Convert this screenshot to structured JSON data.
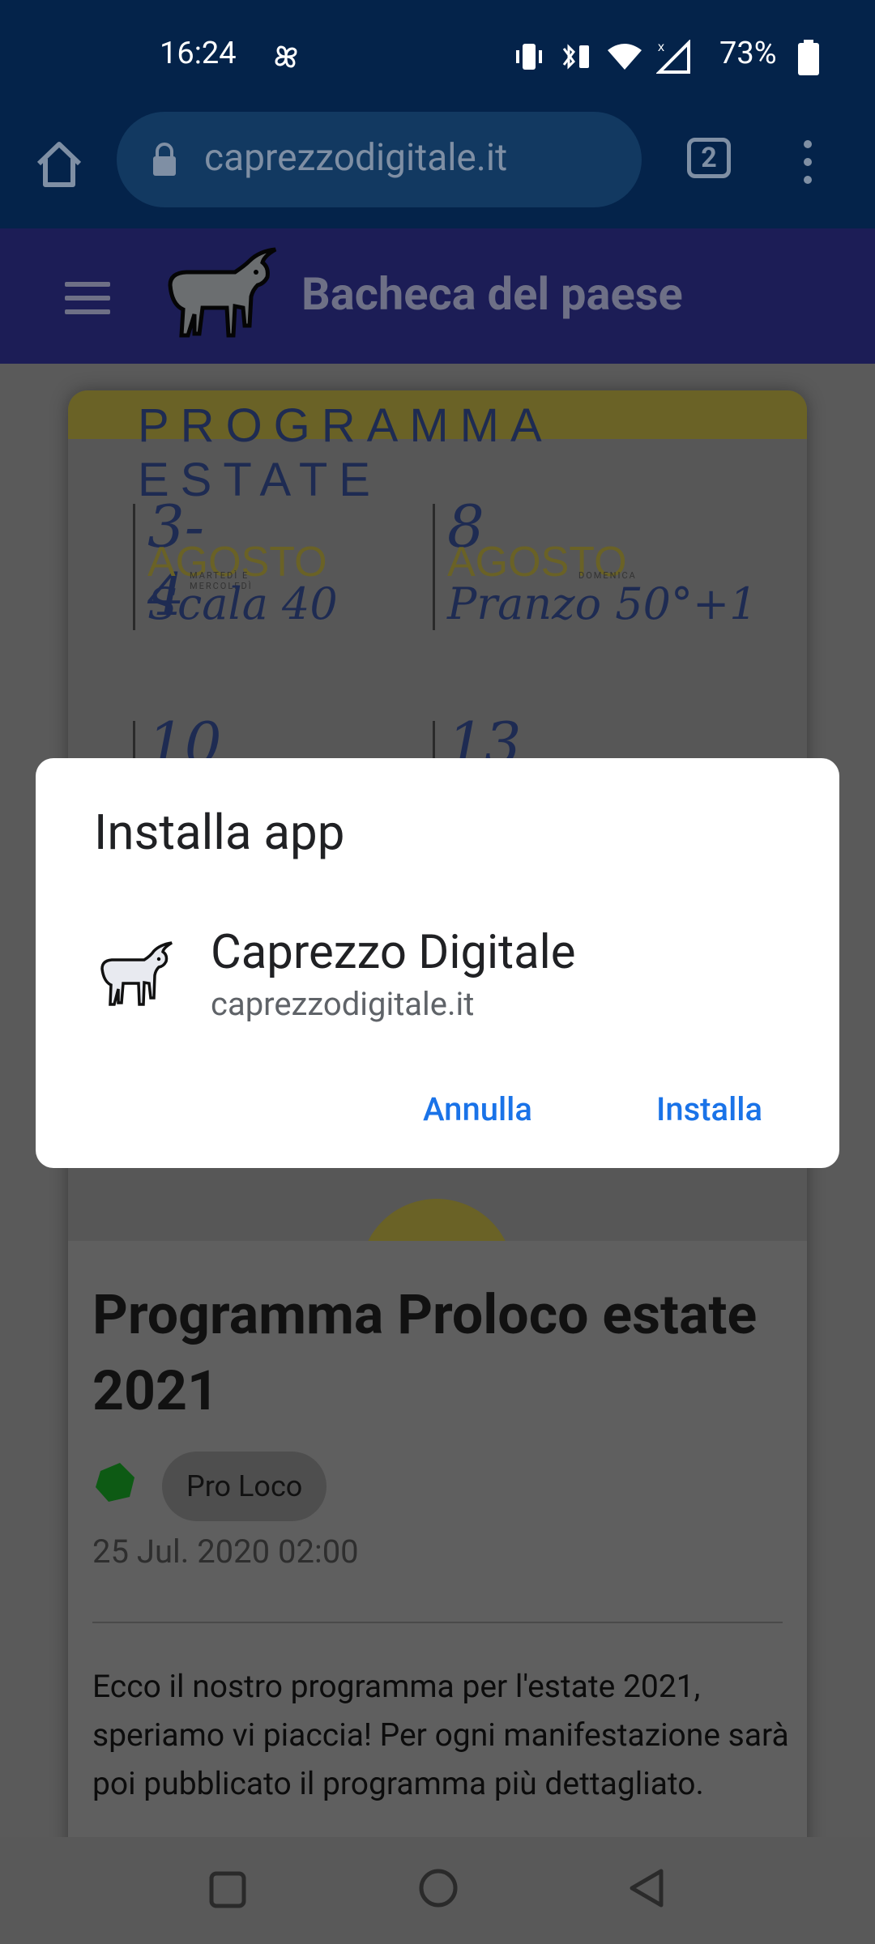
{
  "status_bar": {
    "time": "16:24",
    "battery_percent": "73%",
    "icons": [
      "pinwheel-icon",
      "vibrate-icon",
      "bluetooth-battery-icon",
      "wifi-icon",
      "cell-signal-icon",
      "battery-icon"
    ]
  },
  "browser": {
    "url": "caprezzodigitale.it",
    "tab_count": "2"
  },
  "site": {
    "title": "Bacheca del paese"
  },
  "poster": {
    "title": "PROGRAMMA ESTATE",
    "events": [
      {
        "num": "3-4",
        "month": "AGOSTO",
        "day": "MARTEDÌ E MERCOLEDÌ",
        "name": "Scala 40"
      },
      {
        "num": "8",
        "month": "AGOSTO",
        "day": "DOMENICA",
        "name": "Pranzo 50°+1"
      },
      {
        "num": "10",
        "month": "",
        "day": "",
        "name": ""
      },
      {
        "num": "13",
        "month": "",
        "day": "",
        "name": ""
      }
    ]
  },
  "post": {
    "title": "Programma Proloco estate 2021",
    "tag": "Pro Loco",
    "date": "25 Jul. 2020 02:00",
    "body": "Ecco il nostro programma per l'estate 2021, speriamo vi piaccia! Per ogni manifestazione sarà poi pubblicato il programma più dettagliato."
  },
  "dialog": {
    "title": "Installa app",
    "app_name": "Caprezzo Digitale",
    "app_url": "caprezzodigitale.it",
    "cancel_label": "Annulla",
    "install_label": "Installa"
  },
  "colors": {
    "status_bg": "#04234a",
    "header_bg": "#1c1d56",
    "accent_blue": "#1a73e8",
    "tag_green": "#0d5a14"
  }
}
